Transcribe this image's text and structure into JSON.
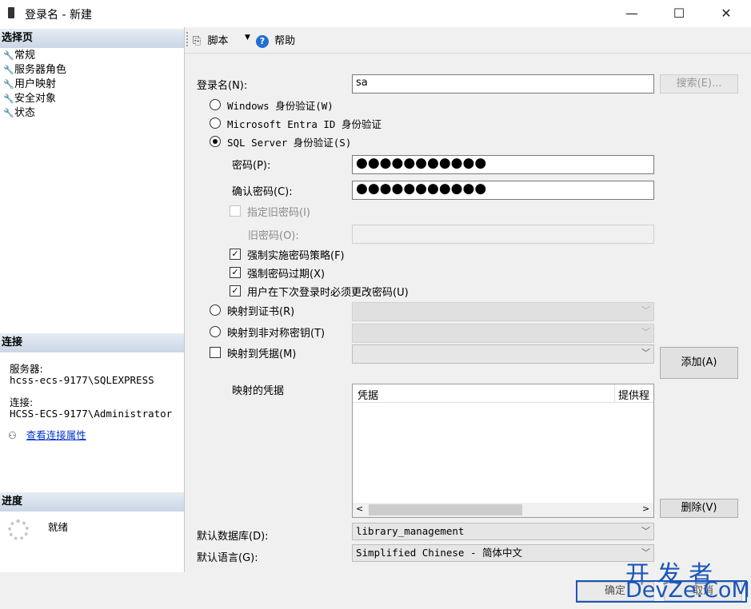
{
  "window": {
    "title": "登录名 - 新建",
    "minimize": "—",
    "maximize": "☐",
    "close": "✕"
  },
  "left": {
    "select_page_header": "选择页",
    "nav_items": [
      "常规",
      "服务器角色",
      "用户映射",
      "安全对象",
      "状态"
    ],
    "connection_header": "连接",
    "server_label": "服务器:",
    "server_value": "hcss-ecs-9177\\SQLEXPRESS",
    "connection_label": "连接:",
    "connection_value": "HCSS-ECS-9177\\Administrator",
    "view_properties": "查看连接属性",
    "progress_header": "进度",
    "progress_status": "就绪"
  },
  "toolbar": {
    "script": "脚本",
    "help": "帮助"
  },
  "form": {
    "login_name_label": "登录名(N):",
    "login_name_value": "sa",
    "search_button": "搜索(E)...",
    "auth_windows": "Windows 身份验证(W)",
    "auth_entra": "Microsoft Entra ID 身份验证",
    "auth_sql": "SQL Server 身份验证(S)",
    "password_label": "密码(P):",
    "password_value": "●●●●●●●●●●●",
    "confirm_label": "确认密码(C):",
    "confirm_value": "●●●●●●●●●●●",
    "specify_old": "指定旧密码(I)",
    "old_password_label": "旧密码(O):",
    "enforce_policy": "强制实施密码策略(F)",
    "enforce_expiration": "强制密码过期(X)",
    "must_change": "用户在下次登录时必须更改密码(U)",
    "map_cert": "映射到证书(R)",
    "map_asym": "映射到非对称密钥(T)",
    "map_cred": "映射到凭据(M)",
    "add_button": "添加(A)",
    "mapped_cred_label": "映射的凭据",
    "grid_col_cred": "凭据",
    "grid_col_provider": "提供程",
    "remove_button": "删除(V)",
    "default_db_label": "默认数据库(D):",
    "default_db_value": "library_management",
    "default_lang_label": "默认语言(G):",
    "default_lang_value": "Simplified Chinese - 简体中文",
    "ok_button": "确定",
    "cancel_button": "取消"
  },
  "watermark": {
    "line1": "开 发 者",
    "line2": "DevZe.CoM"
  },
  "colors": {
    "accent": "#0078d7",
    "link": "#0033cc",
    "header_bg": "#c9d6e5"
  }
}
